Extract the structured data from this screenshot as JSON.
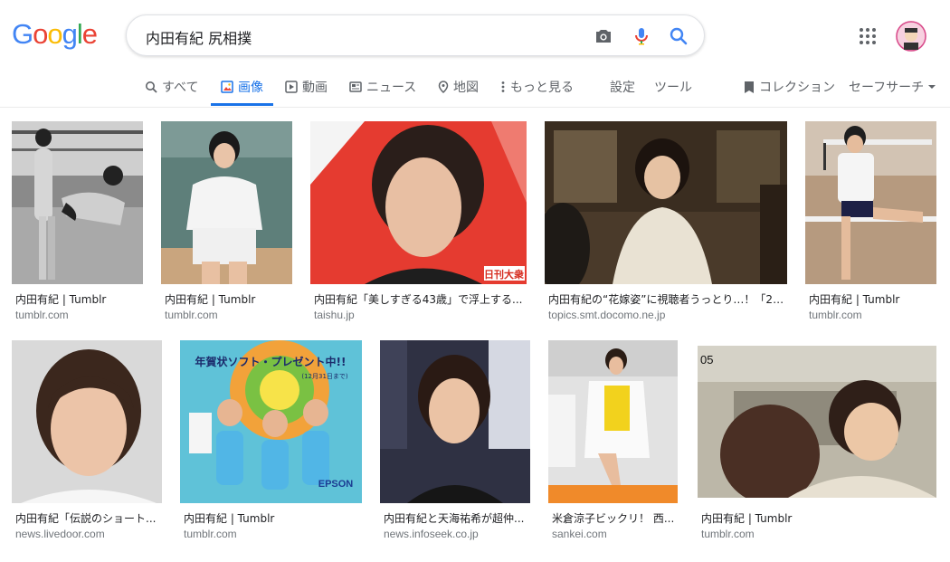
{
  "logo": {
    "letters": [
      "G",
      "o",
      "o",
      "g",
      "l",
      "e"
    ],
    "colors": [
      "#4285F4",
      "#EA4335",
      "#FBBC05",
      "#4285F4",
      "#34A853",
      "#EA4335"
    ]
  },
  "search": {
    "query": "内田有紀 尻相撲"
  },
  "tabs": [
    {
      "label": "すべて",
      "icon": "search-icon"
    },
    {
      "label": "画像",
      "icon": "image-icon",
      "active": true
    },
    {
      "label": "動画",
      "icon": "video-icon"
    },
    {
      "label": "ニュース",
      "icon": "news-icon"
    },
    {
      "label": "地図",
      "icon": "map-pin-icon"
    },
    {
      "label": "もっと見る",
      "icon": "more-vert-icon"
    },
    {
      "label": "設定"
    },
    {
      "label": "ツール"
    }
  ],
  "right_tabs": {
    "collections": "コレクション",
    "safesearch": "セーフサーチ"
  },
  "results": [
    {
      "title": "内田有紀 | Tumblr",
      "domain": "tumblr.com"
    },
    {
      "title": "内田有紀 | Tumblr",
      "domain": "tumblr.com"
    },
    {
      "title": "内田有紀「美しすぎる43歳」で浮上する...",
      "domain": "taishu.jp"
    },
    {
      "title": "内田有紀の“花嫁姿”に視聴者うっとり…！「20...",
      "domain": "topics.smt.docomo.ne.jp"
    },
    {
      "title": "内田有紀 | Tumblr",
      "domain": "tumblr.com"
    },
    {
      "title": "内田有紀「伝説のショート...",
      "domain": "news.livedoor.com"
    },
    {
      "title": "内田有紀 | Tumblr",
      "domain": "tumblr.com"
    },
    {
      "title": "内田有紀と天海祐希が超仲...",
      "domain": "news.infoseek.co.jp"
    },
    {
      "title": "米倉涼子ビックリ！ 西...",
      "domain": "sankei.com"
    },
    {
      "title": "内田有紀 | Tumblr",
      "domain": "tumblr.com"
    }
  ],
  "overlays": {
    "nikkan": "日刊大衆",
    "nenga": "年賀状ソフト・プレゼント中!!",
    "nenga_sub": "(12月31日まで)",
    "epson": "EPSON",
    "frame_no": "05"
  }
}
